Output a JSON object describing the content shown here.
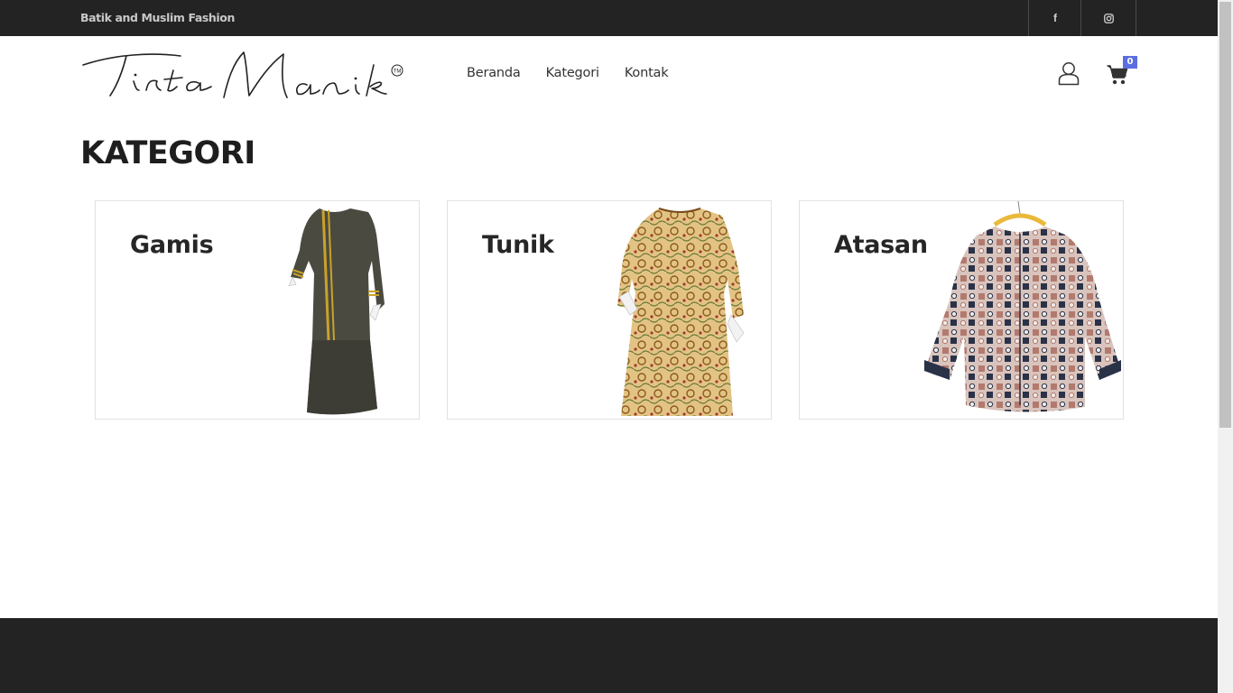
{
  "topbar": {
    "tagline": "Batik and Muslim Fashion",
    "social": [
      {
        "name": "facebook",
        "glyph": "f"
      },
      {
        "name": "instagram",
        "glyph": "instagram-icon"
      }
    ]
  },
  "header": {
    "logo_text": "Tirta Manik",
    "logo_mark": "TM",
    "nav": [
      "Beranda",
      "Kategori",
      "Kontak"
    ],
    "cart_count": "0"
  },
  "main": {
    "title": "KATEGORI",
    "categories": [
      {
        "label": "Gamis"
      },
      {
        "label": "Tunik"
      },
      {
        "label": "Atasan"
      }
    ]
  },
  "colors": {
    "dark_bar": "#232323",
    "badge": "#5b6ee1"
  }
}
